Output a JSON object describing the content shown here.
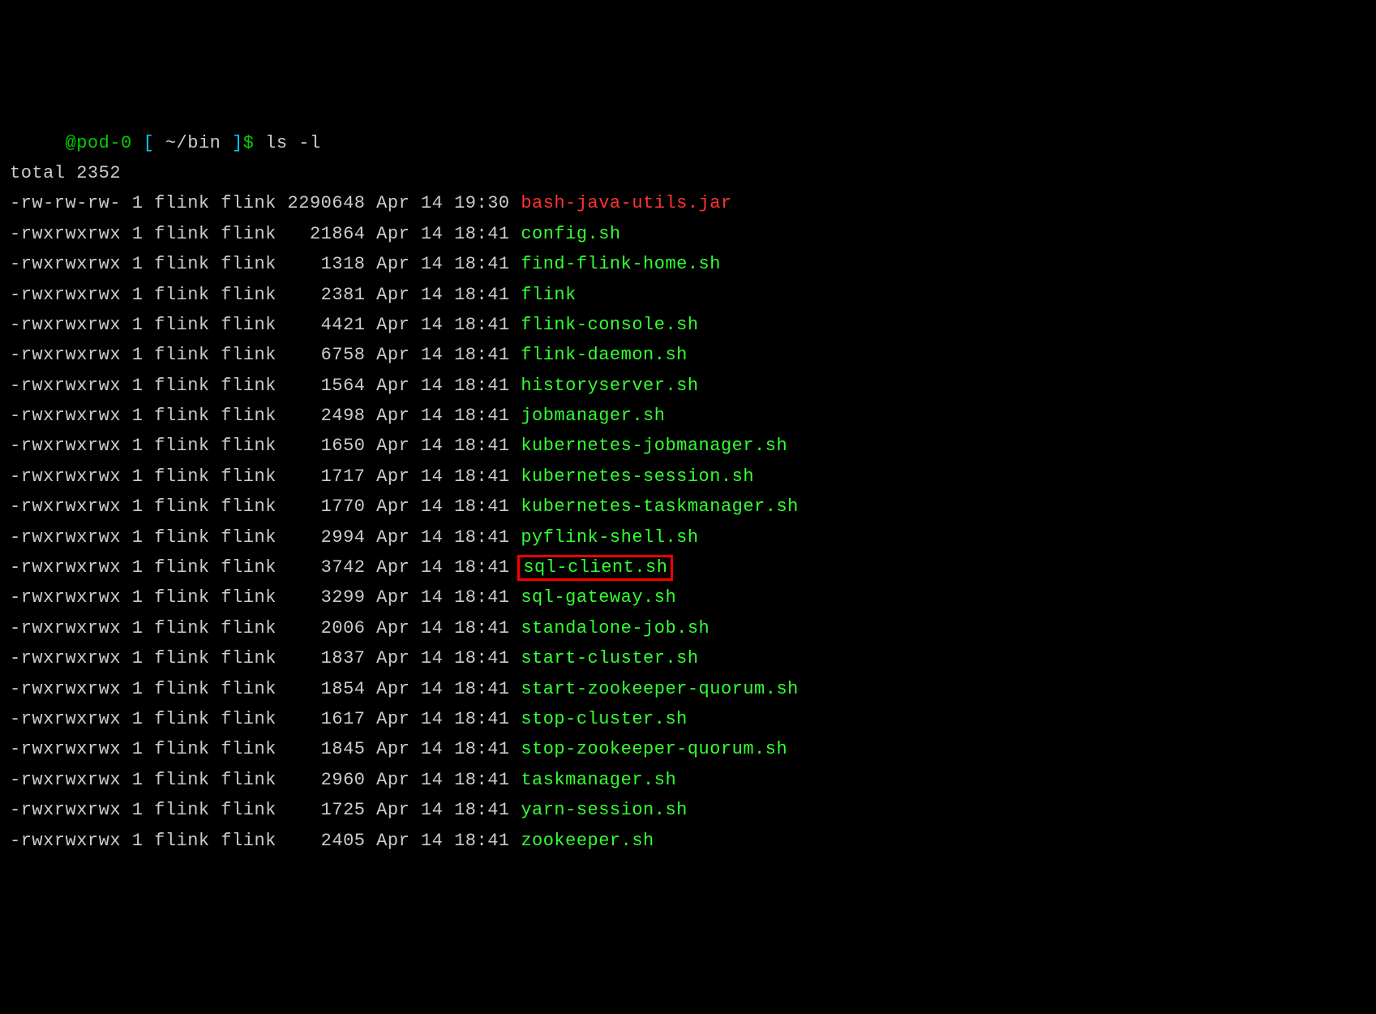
{
  "prompt": {
    "host": "@pod-0",
    "bracket_open": "[",
    "path": "~/bin",
    "bracket_close": "]",
    "dollar": "$",
    "command": "ls -l"
  },
  "total_line": "total 2352",
  "files": [
    {
      "perms": "-rw-rw-rw-",
      "links": "1",
      "owner": "flink",
      "group": "flink",
      "size": "2290648",
      "month": "Apr",
      "day": "14",
      "time": "19:30",
      "name": "bash-java-utils.jar",
      "color": "red",
      "highlighted": false
    },
    {
      "perms": "-rwxrwxrwx",
      "links": "1",
      "owner": "flink",
      "group": "flink",
      "size": "21864",
      "month": "Apr",
      "day": "14",
      "time": "18:41",
      "name": "config.sh",
      "color": "green",
      "highlighted": false
    },
    {
      "perms": "-rwxrwxrwx",
      "links": "1",
      "owner": "flink",
      "group": "flink",
      "size": "1318",
      "month": "Apr",
      "day": "14",
      "time": "18:41",
      "name": "find-flink-home.sh",
      "color": "green",
      "highlighted": false
    },
    {
      "perms": "-rwxrwxrwx",
      "links": "1",
      "owner": "flink",
      "group": "flink",
      "size": "2381",
      "month": "Apr",
      "day": "14",
      "time": "18:41",
      "name": "flink",
      "color": "green",
      "highlighted": false
    },
    {
      "perms": "-rwxrwxrwx",
      "links": "1",
      "owner": "flink",
      "group": "flink",
      "size": "4421",
      "month": "Apr",
      "day": "14",
      "time": "18:41",
      "name": "flink-console.sh",
      "color": "green",
      "highlighted": false
    },
    {
      "perms": "-rwxrwxrwx",
      "links": "1",
      "owner": "flink",
      "group": "flink",
      "size": "6758",
      "month": "Apr",
      "day": "14",
      "time": "18:41",
      "name": "flink-daemon.sh",
      "color": "green",
      "highlighted": false
    },
    {
      "perms": "-rwxrwxrwx",
      "links": "1",
      "owner": "flink",
      "group": "flink",
      "size": "1564",
      "month": "Apr",
      "day": "14",
      "time": "18:41",
      "name": "historyserver.sh",
      "color": "green",
      "highlighted": false
    },
    {
      "perms": "-rwxrwxrwx",
      "links": "1",
      "owner": "flink",
      "group": "flink",
      "size": "2498",
      "month": "Apr",
      "day": "14",
      "time": "18:41",
      "name": "jobmanager.sh",
      "color": "green",
      "highlighted": false
    },
    {
      "perms": "-rwxrwxrwx",
      "links": "1",
      "owner": "flink",
      "group": "flink",
      "size": "1650",
      "month": "Apr",
      "day": "14",
      "time": "18:41",
      "name": "kubernetes-jobmanager.sh",
      "color": "green",
      "highlighted": false
    },
    {
      "perms": "-rwxrwxrwx",
      "links": "1",
      "owner": "flink",
      "group": "flink",
      "size": "1717",
      "month": "Apr",
      "day": "14",
      "time": "18:41",
      "name": "kubernetes-session.sh",
      "color": "green",
      "highlighted": false
    },
    {
      "perms": "-rwxrwxrwx",
      "links": "1",
      "owner": "flink",
      "group": "flink",
      "size": "1770",
      "month": "Apr",
      "day": "14",
      "time": "18:41",
      "name": "kubernetes-taskmanager.sh",
      "color": "green",
      "highlighted": false
    },
    {
      "perms": "-rwxrwxrwx",
      "links": "1",
      "owner": "flink",
      "group": "flink",
      "size": "2994",
      "month": "Apr",
      "day": "14",
      "time": "18:41",
      "name": "pyflink-shell.sh",
      "color": "green",
      "highlighted": false
    },
    {
      "perms": "-rwxrwxrwx",
      "links": "1",
      "owner": "flink",
      "group": "flink",
      "size": "3742",
      "month": "Apr",
      "day": "14",
      "time": "18:41",
      "name": "sql-client.sh",
      "color": "green",
      "highlighted": true
    },
    {
      "perms": "-rwxrwxrwx",
      "links": "1",
      "owner": "flink",
      "group": "flink",
      "size": "3299",
      "month": "Apr",
      "day": "14",
      "time": "18:41",
      "name": "sql-gateway.sh",
      "color": "green",
      "highlighted": false
    },
    {
      "perms": "-rwxrwxrwx",
      "links": "1",
      "owner": "flink",
      "group": "flink",
      "size": "2006",
      "month": "Apr",
      "day": "14",
      "time": "18:41",
      "name": "standalone-job.sh",
      "color": "green",
      "highlighted": false
    },
    {
      "perms": "-rwxrwxrwx",
      "links": "1",
      "owner": "flink",
      "group": "flink",
      "size": "1837",
      "month": "Apr",
      "day": "14",
      "time": "18:41",
      "name": "start-cluster.sh",
      "color": "green",
      "highlighted": false
    },
    {
      "perms": "-rwxrwxrwx",
      "links": "1",
      "owner": "flink",
      "group": "flink",
      "size": "1854",
      "month": "Apr",
      "day": "14",
      "time": "18:41",
      "name": "start-zookeeper-quorum.sh",
      "color": "green",
      "highlighted": false
    },
    {
      "perms": "-rwxrwxrwx",
      "links": "1",
      "owner": "flink",
      "group": "flink",
      "size": "1617",
      "month": "Apr",
      "day": "14",
      "time": "18:41",
      "name": "stop-cluster.sh",
      "color": "green",
      "highlighted": false
    },
    {
      "perms": "-rwxrwxrwx",
      "links": "1",
      "owner": "flink",
      "group": "flink",
      "size": "1845",
      "month": "Apr",
      "day": "14",
      "time": "18:41",
      "name": "stop-zookeeper-quorum.sh",
      "color": "green",
      "highlighted": false
    },
    {
      "perms": "-rwxrwxrwx",
      "links": "1",
      "owner": "flink",
      "group": "flink",
      "size": "2960",
      "month": "Apr",
      "day": "14",
      "time": "18:41",
      "name": "taskmanager.sh",
      "color": "green",
      "highlighted": false
    },
    {
      "perms": "-rwxrwxrwx",
      "links": "1",
      "owner": "flink",
      "group": "flink",
      "size": "1725",
      "month": "Apr",
      "day": "14",
      "time": "18:41",
      "name": "yarn-session.sh",
      "color": "green",
      "highlighted": false
    },
    {
      "perms": "-rwxrwxrwx",
      "links": "1",
      "owner": "flink",
      "group": "flink",
      "size": "2405",
      "month": "Apr",
      "day": "14",
      "time": "18:41",
      "name": "zookeeper.sh",
      "color": "green",
      "highlighted": false
    }
  ]
}
